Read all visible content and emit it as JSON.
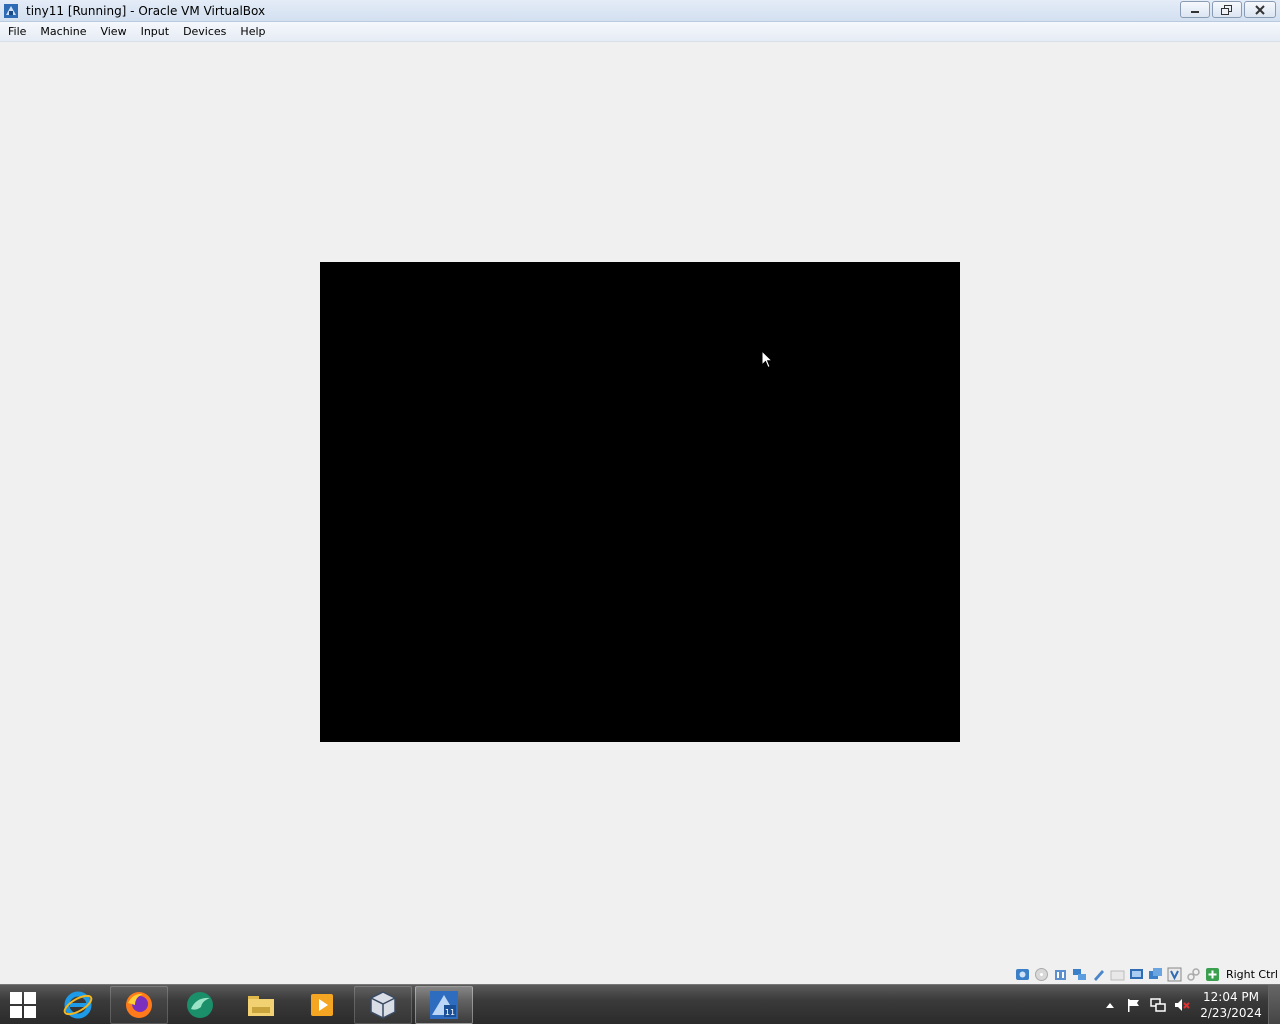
{
  "window": {
    "title": "tiny11 [Running] - Oracle VM VirtualBox"
  },
  "menubar": {
    "items": [
      {
        "label": "File"
      },
      {
        "label": "Machine"
      },
      {
        "label": "View"
      },
      {
        "label": "Input"
      },
      {
        "label": "Devices"
      },
      {
        "label": "Help"
      }
    ]
  },
  "status_bar": {
    "icons": [
      "hard-disk-icon",
      "optical-drive-icon",
      "audio-icon",
      "network-icon",
      "usb-icon",
      "shared-folders-icon",
      "display-icon",
      "video-capture-icon",
      "virtualization-icon",
      "mouse-integration-icon",
      "keyboard-icon"
    ],
    "host_key": "Right Ctrl"
  },
  "taskbar": {
    "apps": [
      {
        "name": "internet-explorer",
        "state": "pinned"
      },
      {
        "name": "firefox",
        "state": "open"
      },
      {
        "name": "bird-app",
        "state": "pinned"
      },
      {
        "name": "file-explorer",
        "state": "pinned"
      },
      {
        "name": "media-player",
        "state": "pinned"
      },
      {
        "name": "virtualbox-manager",
        "state": "open"
      },
      {
        "name": "virtualbox-vm-tiny11",
        "state": "active"
      }
    ],
    "clock": {
      "time": "12:04 PM",
      "date": "2/23/2024"
    }
  }
}
